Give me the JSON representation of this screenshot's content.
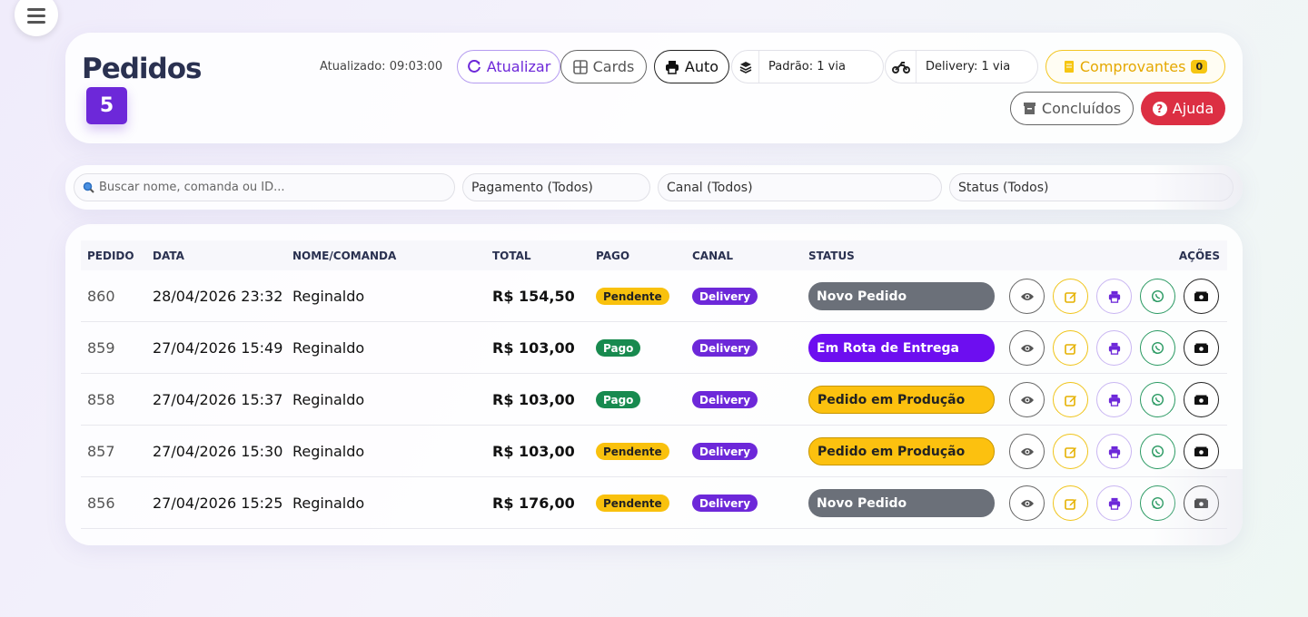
{
  "header": {
    "title": "Pedidos",
    "count": "5",
    "updated": "Atualizado: 09:03:00",
    "refresh_label": "Atualizar",
    "cards_label": "Cards",
    "auto_label": "Auto",
    "printer_default": "Padrão: 1 via",
    "printer_delivery": "Delivery: 1 via",
    "receipts_label": "Comprovantes",
    "receipts_count": "0",
    "done_label": "Concluídos",
    "help_label": "Ajuda"
  },
  "filters": {
    "search_placeholder": "Buscar nome, comanda ou ID...",
    "payment": "Pagamento (Todos)",
    "channel": "Canal (Todos)",
    "status": "Status (Todos)"
  },
  "table": {
    "columns": [
      "PEDIDO",
      "DATA",
      "NOME/COMANDA",
      "TOTAL",
      "PAGO",
      "CANAL",
      "STATUS",
      "AÇÕES"
    ],
    "rows": [
      {
        "id": "860",
        "date": "28/04/2026 23:32",
        "name": "Reginaldo",
        "total": "R$ 154,50",
        "paid": "Pendente",
        "channel": "Delivery",
        "status": "Novo Pedido"
      },
      {
        "id": "859",
        "date": "27/04/2026 15:49",
        "name": "Reginaldo",
        "total": "R$ 103,00",
        "paid": "Pago",
        "channel": "Delivery",
        "status": "Em Rota de Entrega"
      },
      {
        "id": "858",
        "date": "27/04/2026 15:37",
        "name": "Reginaldo",
        "total": "R$ 103,00",
        "paid": "Pago",
        "channel": "Delivery",
        "status": "Pedido em Produção"
      },
      {
        "id": "857",
        "date": "27/04/2026 15:30",
        "name": "Reginaldo",
        "total": "R$ 103,00",
        "paid": "Pendente",
        "channel": "Delivery",
        "status": "Pedido em Produção"
      },
      {
        "id": "856",
        "date": "27/04/2026 15:25",
        "name": "Reginaldo",
        "total": "R$ 176,00",
        "paid": "Pendente",
        "channel": "Delivery",
        "status": "Novo Pedido"
      }
    ]
  },
  "icons": {
    "menu": "menu-icon",
    "refresh": "refresh-icon",
    "cards": "grid-icon",
    "printer": "printer-icon",
    "layers": "layers-icon",
    "motorcycle": "motorcycle-icon",
    "receipt": "receipt-icon",
    "archive": "archive-icon",
    "help": "help-icon",
    "search": "search-icon",
    "view": "eye-icon",
    "edit": "edit-icon",
    "whatsapp": "whatsapp-icon",
    "cash": "cash-icon"
  },
  "colors": {
    "accent": "#6d28d9",
    "pending": "#f9c10d",
    "paid": "#188a4f",
    "help": "#dc2f43",
    "status_new": "#6b7079",
    "status_route": "#6d0ef0",
    "status_production": "#fcc10f"
  }
}
